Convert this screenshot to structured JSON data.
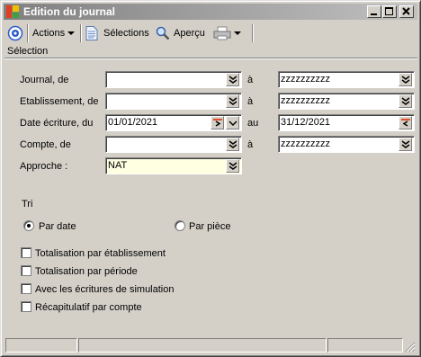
{
  "window": {
    "title": "Edition du journal"
  },
  "toolbar": {
    "actions_label": "Actions",
    "selections_label": "Sélections",
    "apercu_label": "Aperçu"
  },
  "section": {
    "label": "Sélection"
  },
  "form": {
    "journal": {
      "label": "Journal, de",
      "from": "",
      "sep": "à",
      "to": "zzzzzzzzzz"
    },
    "etablissement": {
      "label": "Etablissement, de",
      "from": "",
      "sep": "à",
      "to": "zzzzzzzzzz"
    },
    "date": {
      "label": "Date écriture, du",
      "from": "01/01/2021",
      "sep": "au",
      "to": "31/12/2021"
    },
    "compte": {
      "label": "Compte, de",
      "from": "",
      "sep": "à",
      "to": "zzzzzzzzzz"
    },
    "approche": {
      "label": "Approche :",
      "value": "NAT"
    }
  },
  "tri": {
    "label": "Tri",
    "options": [
      {
        "label": "Par date",
        "selected": true
      },
      {
        "label": "Par pièce",
        "selected": false
      }
    ]
  },
  "checkboxes": [
    {
      "label": "Totalisation par établissement",
      "checked": false
    },
    {
      "label": "Totalisation par période",
      "checked": false
    },
    {
      "label": "Avec les écritures de simulation",
      "checked": false
    },
    {
      "label": "Récapitulatif par compte",
      "checked": false
    }
  ],
  "colors": {
    "window_bg": "#d4d0c8",
    "title_gradient_start": "#808080",
    "title_gradient_end": "#c0c0c0",
    "highlight_field": "#ffffe1",
    "date_icon_accent": "#e05030"
  },
  "icons": [
    "app-icon",
    "minimize-icon",
    "maximize-icon",
    "close-icon",
    "target-icon",
    "document-icon",
    "magnifier-icon",
    "printer-icon",
    "dropdown-double-chevron-icon",
    "calendar-icon"
  ]
}
